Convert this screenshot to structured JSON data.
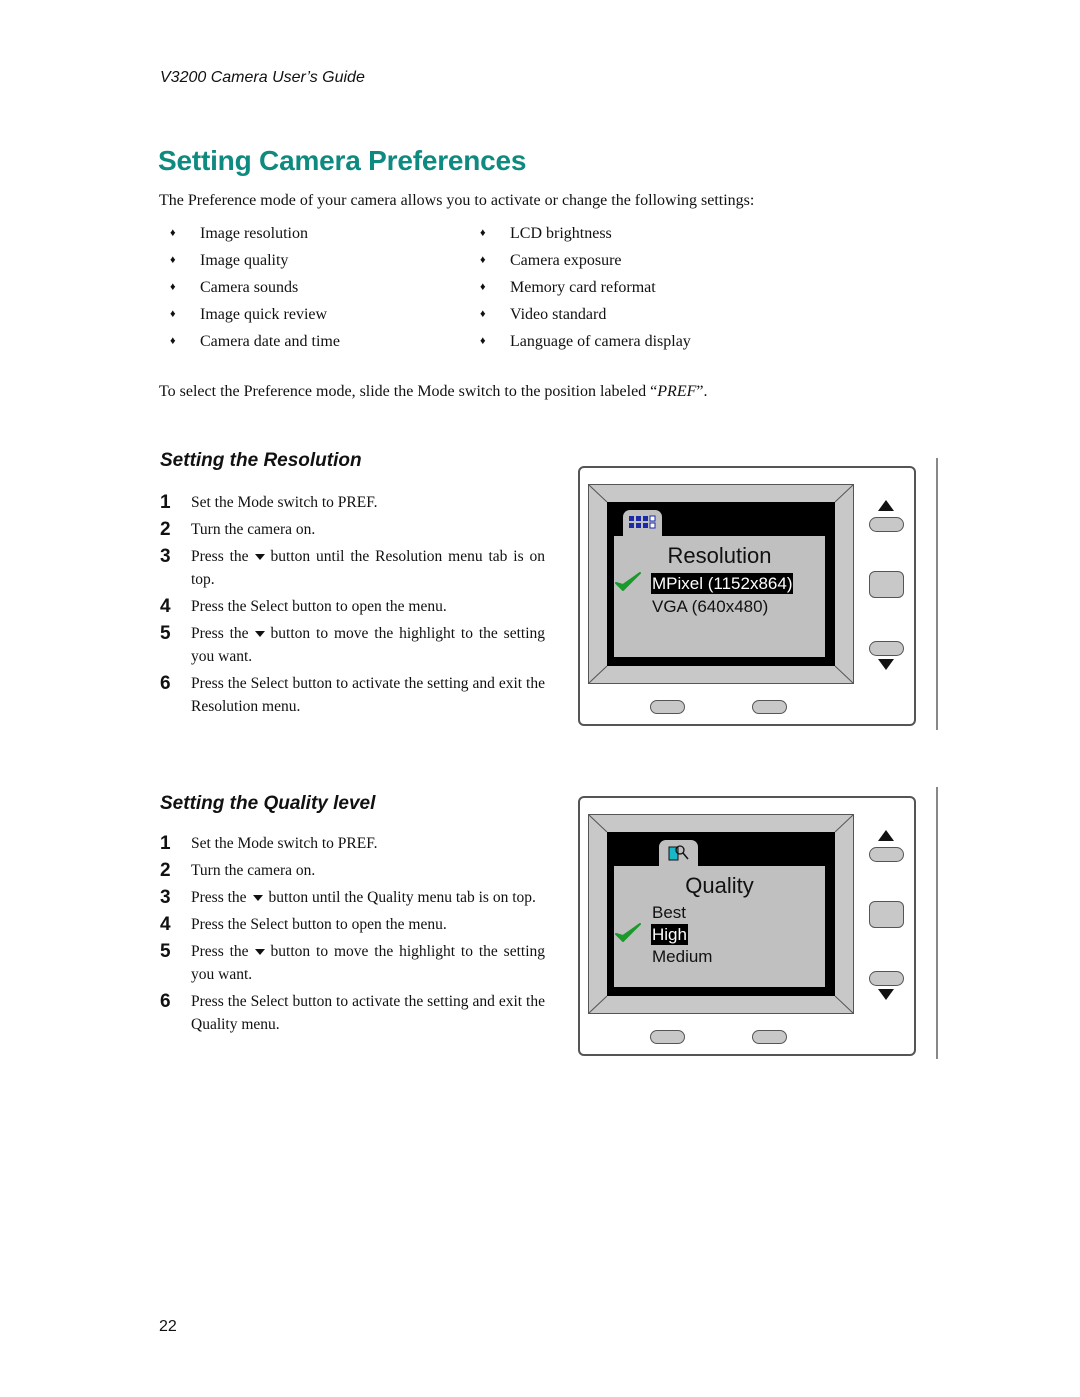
{
  "header": {
    "running_title": "V3200 Camera User’s Guide"
  },
  "page": {
    "title": "Setting Camera Preferences",
    "intro": "The Preference mode of your camera allows you to activate or change the following settings:",
    "settings_left": [
      "Image resolution",
      "Image quality",
      "Camera sounds",
      "Image quick review",
      "Camera date and time"
    ],
    "settings_right": [
      "LCD brightness",
      "Camera exposure",
      "Memory card reformat",
      "Video standard",
      "Language of camera display"
    ],
    "pref_note_before": "To select the Preference mode, slide the Mode switch to the position labeled “",
    "pref_note_em": "PREF",
    "pref_note_after": "”.",
    "page_number": "22"
  },
  "bullet_glyph": "♦",
  "sections": [
    {
      "heading": "Setting the Resolution",
      "steps": [
        {
          "n": "1",
          "pre": "Set the Mode switch to PREF.",
          "post": ""
        },
        {
          "n": "2",
          "pre": "Turn the camera on.",
          "post": ""
        },
        {
          "n": "3",
          "pre": "Press the",
          "post": "button until the Resolution menu tab is on top."
        },
        {
          "n": "4",
          "pre": "Press the Select button to open the menu.",
          "post": ""
        },
        {
          "n": "5",
          "pre": "Press the",
          "post": "button to move the highlight to the setting you want."
        },
        {
          "n": "6",
          "pre": "Press the Select button to activate the setting and exit the Resolution menu.",
          "post": ""
        }
      ],
      "screen": {
        "tab_icon": "resolution-grid-icon",
        "menu_title": "Resolution",
        "options": [
          "MPixel (1152x864)",
          "VGA (640x480)"
        ],
        "selected_index": 0,
        "checked_index": 0
      }
    },
    {
      "heading": "Setting the Quality level",
      "steps": [
        {
          "n": "1",
          "pre": "Set the Mode switch to PREF.",
          "post": ""
        },
        {
          "n": "2",
          "pre": "Turn the camera on.",
          "post": ""
        },
        {
          "n": "3",
          "pre": "Press the",
          "post": "button until the Quality menu tab is on top."
        },
        {
          "n": "4",
          "pre": "Press the Select button to open the menu.",
          "post": ""
        },
        {
          "n": "5",
          "pre": "Press the",
          "post": "button to move the highlight to the setting you want."
        },
        {
          "n": "6",
          "pre": "Press the Select button to activate the setting and exit the Quality menu.",
          "post": ""
        }
      ],
      "screen": {
        "tab_icon": "quality-magnifier-icon",
        "menu_title": "Quality",
        "options": [
          "Best",
          "High",
          "Medium"
        ],
        "selected_index": 1,
        "checked_index": 1
      }
    }
  ],
  "colors": {
    "title": "#0f8a80",
    "check": "#1a9a2a",
    "grid_icon": "#1a2aa8",
    "quality_icon": "#18b8c8"
  }
}
